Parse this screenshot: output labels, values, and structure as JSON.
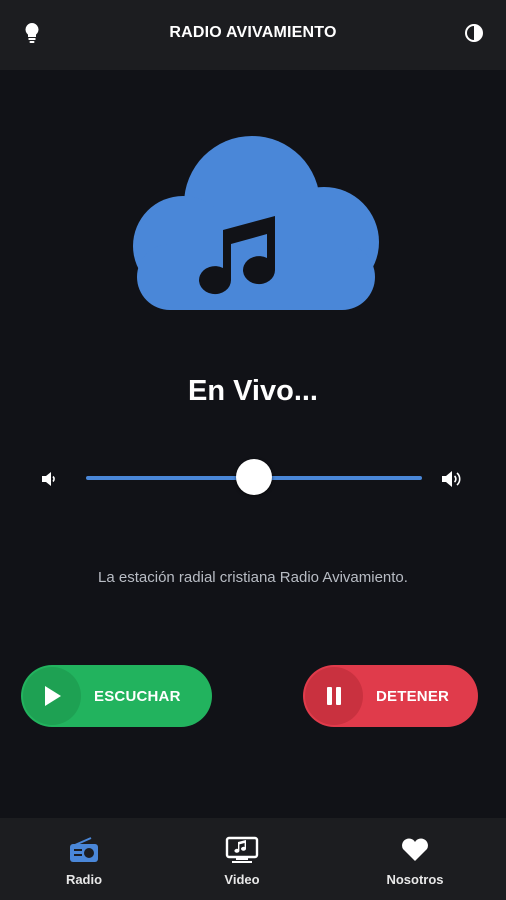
{
  "app": {
    "title": "RADIO AVIVAMIENTO"
  },
  "header": {
    "left_icon": "lightbulb-icon",
    "right_icon": "contrast-icon"
  },
  "player": {
    "status": "En Vivo...",
    "volume": 0.5,
    "description": "La estación radial cristiana Radio Avivamiento."
  },
  "buttons": {
    "play_label": "ESCUCHAR",
    "stop_label": "DETENER"
  },
  "nav": {
    "items": [
      {
        "label": "Radio",
        "icon": "radio-icon",
        "active": true
      },
      {
        "label": "Video",
        "icon": "video-icon",
        "active": false
      },
      {
        "label": "Nosotros",
        "icon": "heart-icon",
        "active": false
      }
    ]
  },
  "colors": {
    "accent": "#4a87d8",
    "play": "#22b35e",
    "stop": "#e03b4b",
    "background": "#111217",
    "bar": "#1c1d20"
  }
}
